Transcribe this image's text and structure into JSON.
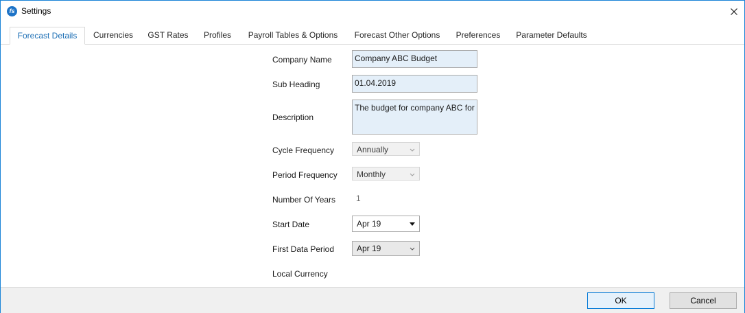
{
  "window": {
    "title": "Settings",
    "app_icon_glyph": "fs"
  },
  "tabs": [
    {
      "label": "Forecast Details",
      "active": true
    },
    {
      "label": "Currencies"
    },
    {
      "label": "GST Rates"
    },
    {
      "label": "Profiles"
    },
    {
      "label": "Payroll Tables & Options"
    },
    {
      "label": "Forecast Other Options"
    },
    {
      "label": "Preferences"
    },
    {
      "label": "Parameter Defaults"
    }
  ],
  "form": {
    "company_name": {
      "label": "Company Name",
      "value": "Company ABC Budget"
    },
    "sub_heading": {
      "label": "Sub Heading",
      "value": "01.04.2019"
    },
    "description": {
      "label": "Description",
      "value": "The budget for company ABC for"
    },
    "cycle_frequency": {
      "label": "Cycle Frequency",
      "value": "Annually"
    },
    "period_frequency": {
      "label": "Period Frequency",
      "value": "Monthly"
    },
    "number_of_years": {
      "label": "Number Of Years",
      "value": "1"
    },
    "start_date": {
      "label": "Start Date",
      "value": "Apr 19"
    },
    "first_data_period": {
      "label": "First Data Period",
      "value": "Apr 19"
    },
    "local_currency": {
      "label": "Local Currency"
    }
  },
  "buttons": {
    "ok": "OK",
    "cancel": "Cancel"
  },
  "colors": {
    "accent": "#1d6fb5",
    "input_background": "#e4eff9",
    "window_border": "#1883d7"
  }
}
